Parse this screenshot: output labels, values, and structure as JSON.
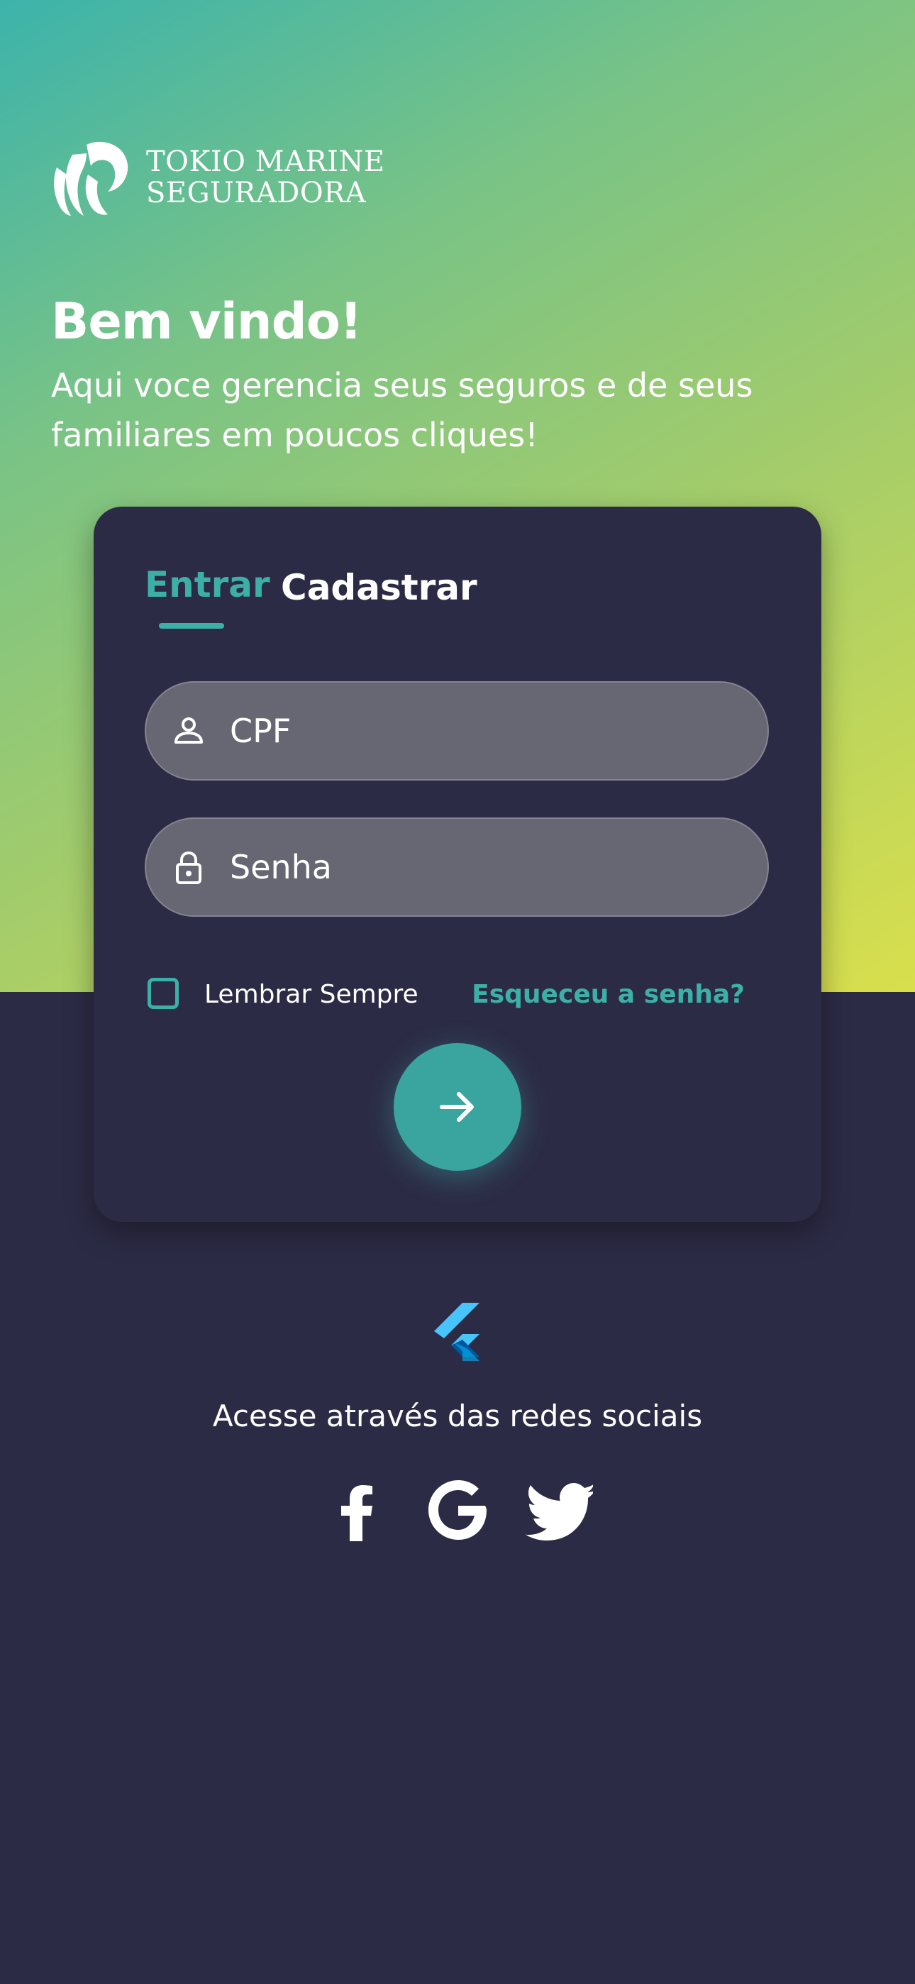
{
  "brand": {
    "name_line1": "TOKIO MARINE",
    "name_line2": "SEGURADORA"
  },
  "welcome": {
    "title": "Bem vindo!",
    "subtitle": "Aqui voce gerencia seus seguros e de seus familiares em poucos cliques!"
  },
  "auth": {
    "tabs": [
      "Entrar",
      "Cadastrar"
    ],
    "active_tab": "Entrar",
    "fields": {
      "cpf_placeholder": "CPF",
      "password_placeholder": "Senha"
    },
    "remember_label": "Lembrar Sempre",
    "remember_checked": false,
    "forgot_label": "Esqueceu a senha?",
    "submit_icon": "arrow-right-icon"
  },
  "social": {
    "caption": "Acesse através das redes sociais",
    "providers": [
      "facebook-icon",
      "google-icon",
      "twitter-icon"
    ]
  },
  "colors": {
    "accent": "#3cb0a7",
    "background": "#2c2b45",
    "gradient_start": "#3cb3ab",
    "gradient_end": "#d9df4c",
    "field_bg": "#676673"
  }
}
